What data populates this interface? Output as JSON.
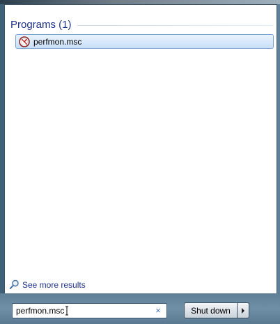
{
  "results": {
    "group_title": "Programs (1)",
    "items": [
      {
        "label": "perfmon.msc",
        "icon": "perfmon-icon"
      }
    ]
  },
  "see_more": {
    "label": "See more results",
    "icon": "search-magnifier-icon"
  },
  "search": {
    "value": "perfmon.msc",
    "clear_glyph": "×"
  },
  "shutdown": {
    "label": "Shut down",
    "arrow_icon": "triangle-right-icon"
  },
  "colors": {
    "group_title": "#1e3287",
    "link": "#1e3287",
    "selection_border": "#7da2ce",
    "selection_fill": "#d9e9fb"
  }
}
